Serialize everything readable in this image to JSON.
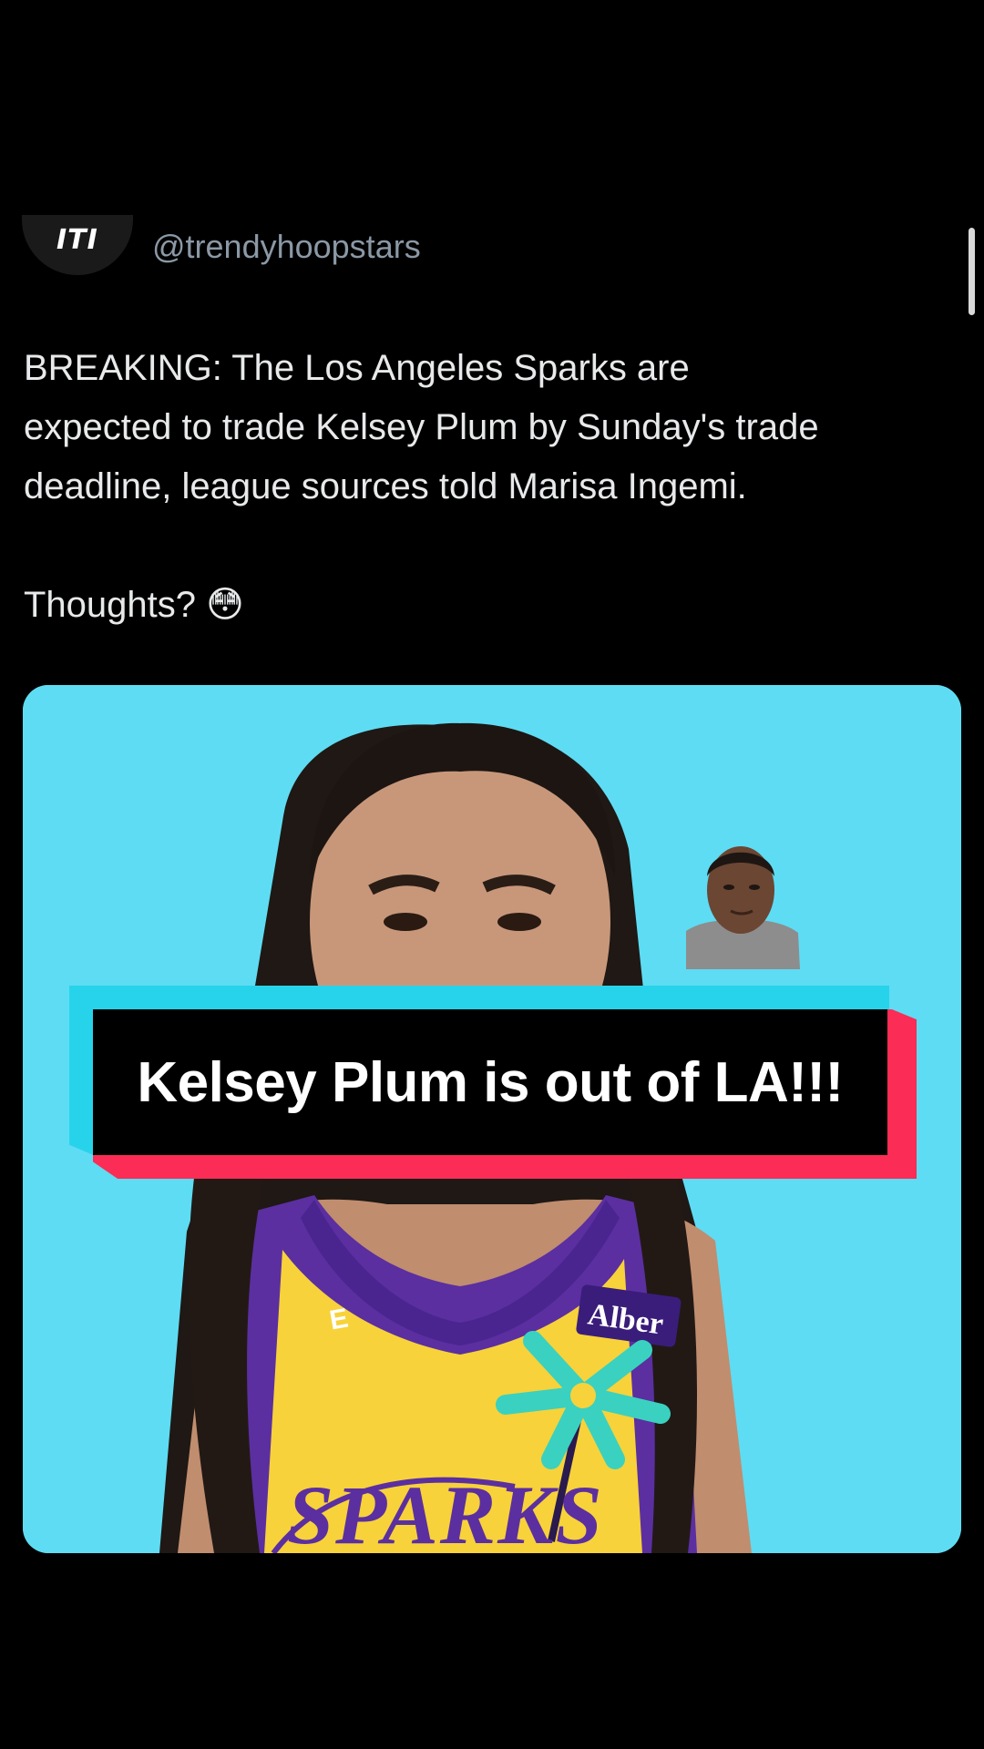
{
  "account": {
    "avatar_text": "ITI",
    "handle": "@trendyhoopstars"
  },
  "post": {
    "body": "BREAKING: The Los Angeles Sparks are\nexpected to trade Kelsey Plum by Sunday's trade\ndeadline, league sources told Marisa Ingemi.\n\nThoughts? 😳"
  },
  "media": {
    "jersey_sponsor": "Alber",
    "jersey_team": "SPARKS",
    "nike_mark": "E",
    "colors": {
      "background": "#5edcf3",
      "jersey_yellow": "#f7d23a",
      "jersey_purple": "#5b2fa0",
      "palm_teal": "#3ad1c0"
    }
  },
  "caption": {
    "text": "Kelsey Plum is out of LA!!!",
    "colors": {
      "cyan": "#27d3ea",
      "red": "#fb2c55",
      "black": "#000000"
    }
  }
}
